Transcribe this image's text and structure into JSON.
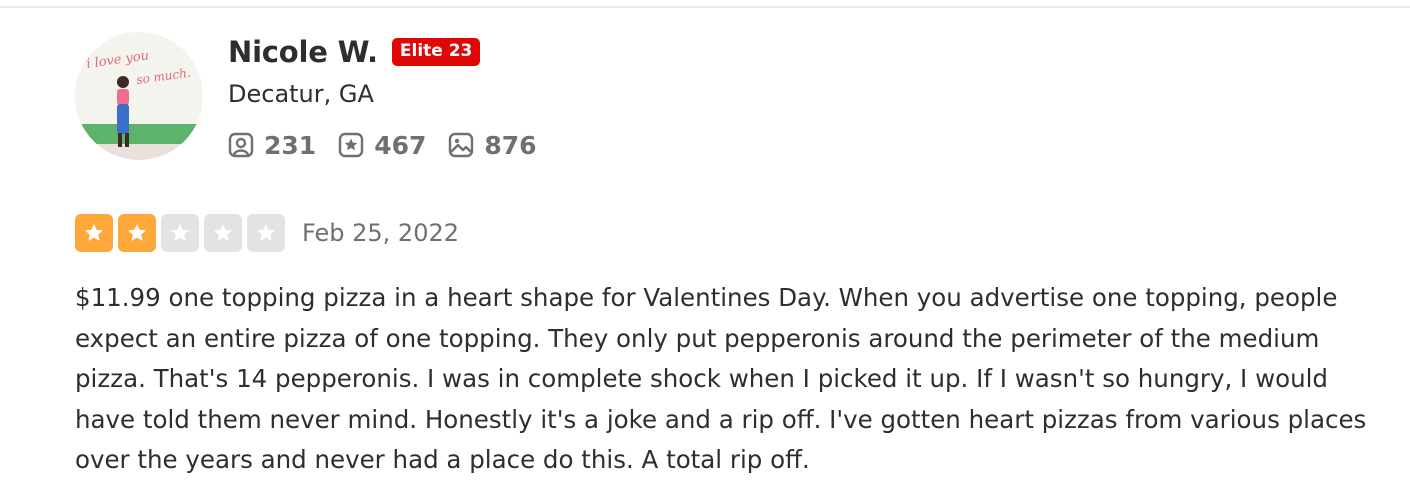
{
  "user": {
    "name": "Nicole W.",
    "elite_badge": "Elite 23",
    "location": "Decatur, GA",
    "stats": {
      "friends": "231",
      "reviews": "467",
      "photos": "876"
    }
  },
  "review": {
    "rating": 2,
    "max_rating": 5,
    "date": "Feb 25, 2022",
    "text": "$11.99 one topping pizza in a heart shape for Valentines Day. When you advertise one topping, people expect an entire pizza of one topping. They only put pepperonis around the perimeter of the medium pizza. That's 14 pepperonis. I was in complete shock when I picked it up. If I wasn't so hungry, I would have told them never mind. Honestly it's a joke and a rip off. I've gotten heart pizzas from various places over the years and never had a place do this. A total rip off."
  },
  "icons": {
    "friends": "friends-icon",
    "reviews": "review-star-icon",
    "photos": "photo-icon",
    "star": "star-icon"
  },
  "colors": {
    "elite_red": "#e00707",
    "star_filled": "#fea73a",
    "star_empty": "#e3e3e3",
    "muted_text": "#6e7072"
  }
}
